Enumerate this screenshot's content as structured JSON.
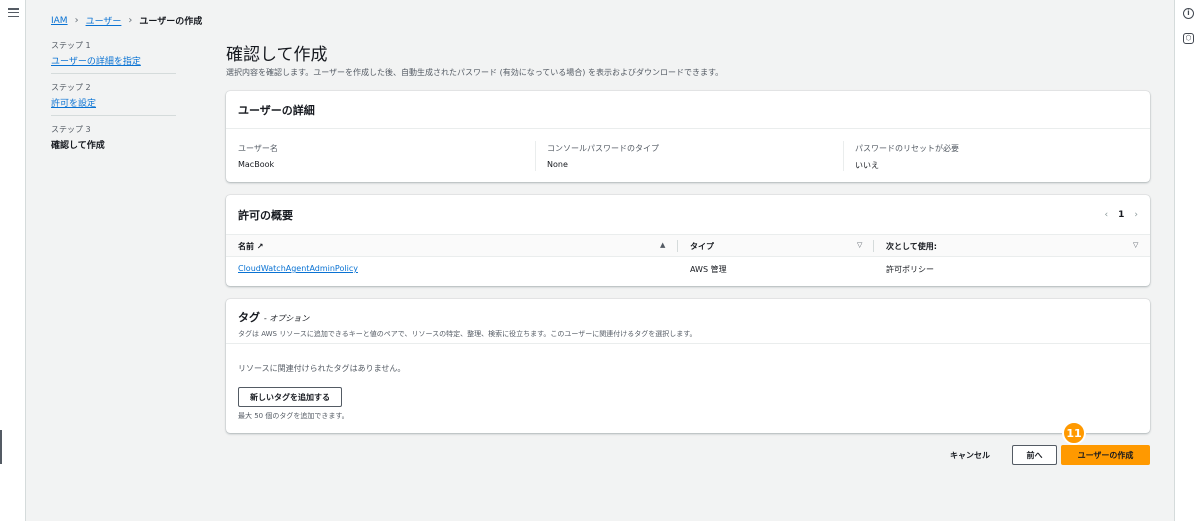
{
  "breadcrumb": {
    "root": "IAM",
    "section": "ユーザー",
    "current": "ユーザーの作成"
  },
  "steps": [
    {
      "num": "ステップ 1",
      "label": "ユーザーの詳細を指定"
    },
    {
      "num": "ステップ 2",
      "label": "許可を設定"
    },
    {
      "num": "ステップ 3",
      "label": "確認して作成"
    }
  ],
  "page": {
    "title": "確認して作成",
    "description": "選択内容を確認します。ユーザーを作成した後、自動生成されたパスワード (有効になっている場合) を表示およびダウンロードできます。"
  },
  "user_details": {
    "title": "ユーザーの詳細",
    "fields": [
      {
        "key": "ユーザー名",
        "value": "MacBook"
      },
      {
        "key": "コンソールパスワードのタイプ",
        "value": "None"
      },
      {
        "key": "パスワードのリセットが必要",
        "value": "いいえ"
      }
    ]
  },
  "permissions": {
    "title": "許可の概要",
    "page": "1",
    "columns": [
      "名前",
      "タイプ",
      "次として使用:"
    ],
    "rows": [
      {
        "name": "CloudWatchAgentAdminPolicy",
        "type": "AWS 管理",
        "use": "許可ポリシー"
      }
    ]
  },
  "tags": {
    "title": "タグ",
    "optional": "- オプション",
    "description": "タグは AWS リソースに追加できるキーと値のペアで、リソースの特定、整理、検索に役立ちます。このユーザーに関連付けるタグを選択します。",
    "empty": "リソースに関連付けられたタグはありません。",
    "add_button": "新しいタグを追加する",
    "limit": "最大 50 個のタグを追加できます。"
  },
  "actions": {
    "cancel": "キャンセル",
    "prev": "前へ",
    "create": "ユーザーの作成"
  },
  "annotation_badge": "11",
  "colors": {
    "accent": "#ff9900",
    "link": "#0972d3"
  }
}
